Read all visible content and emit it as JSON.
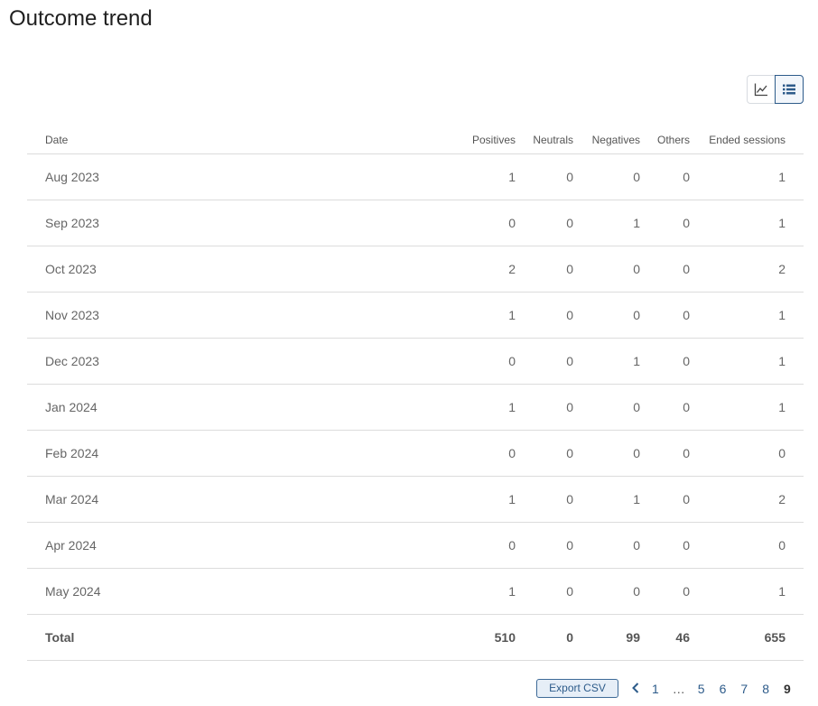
{
  "page": {
    "title": "Outcome trend"
  },
  "view_toggle": {
    "chart_icon": "line-chart-icon",
    "table_icon": "list-icon",
    "active": "table",
    "accent_color": "#2d5b8a"
  },
  "table": {
    "headers": {
      "date": "Date",
      "positives": "Positives",
      "neutrals": "Neutrals",
      "negatives": "Negatives",
      "others": "Others",
      "ended": "Ended sessions"
    },
    "rows": [
      {
        "date": "Aug 2023",
        "positives": "1",
        "neutrals": "0",
        "negatives": "0",
        "others": "0",
        "ended": "1"
      },
      {
        "date": "Sep 2023",
        "positives": "0",
        "neutrals": "0",
        "negatives": "1",
        "others": "0",
        "ended": "1"
      },
      {
        "date": "Oct 2023",
        "positives": "2",
        "neutrals": "0",
        "negatives": "0",
        "others": "0",
        "ended": "2"
      },
      {
        "date": "Nov 2023",
        "positives": "1",
        "neutrals": "0",
        "negatives": "0",
        "others": "0",
        "ended": "1"
      },
      {
        "date": "Dec 2023",
        "positives": "0",
        "neutrals": "0",
        "negatives": "1",
        "others": "0",
        "ended": "1"
      },
      {
        "date": "Jan 2024",
        "positives": "1",
        "neutrals": "0",
        "negatives": "0",
        "others": "0",
        "ended": "1"
      },
      {
        "date": "Feb 2024",
        "positives": "0",
        "neutrals": "0",
        "negatives": "0",
        "others": "0",
        "ended": "0"
      },
      {
        "date": "Mar 2024",
        "positives": "1",
        "neutrals": "0",
        "negatives": "1",
        "others": "0",
        "ended": "2"
      },
      {
        "date": "Apr 2024",
        "positives": "0",
        "neutrals": "0",
        "negatives": "0",
        "others": "0",
        "ended": "0"
      },
      {
        "date": "May 2024",
        "positives": "1",
        "neutrals": "0",
        "negatives": "0",
        "others": "0",
        "ended": "1"
      }
    ],
    "total": {
      "label": "Total",
      "positives": "510",
      "neutrals": "0",
      "negatives": "99",
      "others": "46",
      "ended": "655"
    }
  },
  "footer": {
    "export_label": "Export CSV",
    "pagination": {
      "prev_icon": "chevron-left-icon",
      "pages": [
        "1",
        "…",
        "5",
        "6",
        "7",
        "8",
        "9"
      ],
      "current": "9"
    }
  }
}
